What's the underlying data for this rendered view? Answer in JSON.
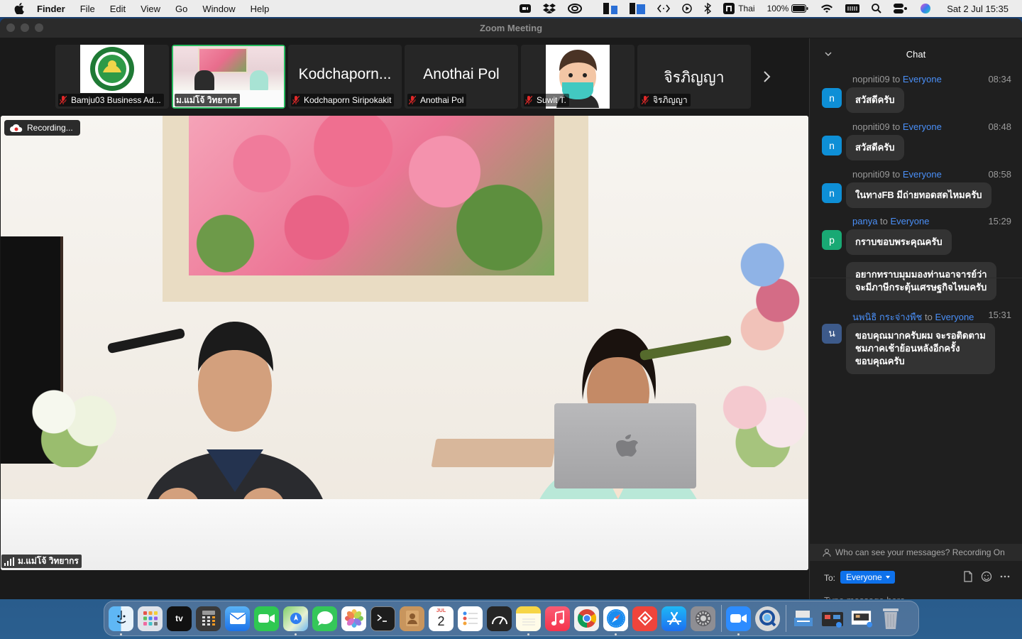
{
  "menubar": {
    "app_name": "Finder",
    "items": [
      "File",
      "Edit",
      "View",
      "Go",
      "Window",
      "Help"
    ],
    "status": {
      "input_source": "Thai",
      "battery": "100%",
      "datetime": "Sat 2 Jul  15:35"
    }
  },
  "window": {
    "title": "Zoom Meeting"
  },
  "thumbnails": [
    {
      "label": "Bamju03 Business Ad...",
      "type": "logo",
      "icon": "university-logo"
    },
    {
      "label": "ม.แม่โจ้ วิทยากร",
      "type": "camera",
      "active": true
    },
    {
      "label": "Kodchaporn Siripokakit",
      "big_name": "Kodchaporn...",
      "type": "name"
    },
    {
      "label": "Anothai Pol",
      "big_name": "Anothai Pol",
      "type": "name"
    },
    {
      "label": "Suwit T.",
      "type": "avatar",
      "icon": "masked-avatar"
    },
    {
      "label": "จิรภิญญา",
      "big_name": "จิรภิญญา",
      "type": "name"
    }
  ],
  "main_video": {
    "recording_label": "Recording...",
    "speaker_name": "ม.แม่โจ้ วิทยากร"
  },
  "chat": {
    "title": "Chat",
    "messages": [
      {
        "from": "nopniti09",
        "to_word": "to",
        "to": "Everyone",
        "time": "08:34",
        "avatar": "n",
        "avatar_color": "#0e8fd6",
        "text": "สวัสดีครับ"
      },
      {
        "from": "nopniti09",
        "to_word": "to",
        "to": "Everyone",
        "time": "08:48",
        "avatar": "n",
        "avatar_color": "#0e8fd6",
        "text": "สวัสดีครับ"
      },
      {
        "from": "nopniti09",
        "to_word": "to",
        "to": "Everyone",
        "time": "08:58",
        "avatar": "n",
        "avatar_color": "#0e8fd6",
        "text": "ในทางFB มีถ่ายทอดสดไหมครับ"
      },
      {
        "from": "panya",
        "to_word": "to",
        "to": "Everyone",
        "time": "15:29",
        "avatar": "p",
        "avatar_color": "#19a974",
        "text": "กราบขอบพระคุณครับ",
        "text2": [
          "อยากทราบมุมมองท่านอาจารย์ว่า",
          "จะมีภาษีกระตุ้นเศรษฐกิจไหมครับ"
        ]
      },
      {
        "from": "นพนิธิ กระจ่างพืช",
        "to_word": "to",
        "to": "Everyone",
        "time": "15:31",
        "avatar": "น",
        "avatar_color": "#3d5a8a",
        "text_lines": [
          "ขอบคุณมากครับผม จะรอติดตาม",
          "ชมภาคเช้าย้อนหลังอีกครั้ง",
          "ขอบคุณครับ"
        ]
      }
    ],
    "privacy_notice": "Who can see your messages? Recording On",
    "to_label": "To:",
    "recipient": "Everyone",
    "input_placeholder": "Type message here..."
  },
  "dock": {
    "apps": [
      "finder-icon",
      "launchpad-icon",
      "apple-tv-icon",
      "calculator-icon",
      "mail-icon",
      "facetime-icon",
      "maps-icon",
      "messages-icon",
      "photos-icon",
      "terminal-icon",
      "contacts-icon",
      "calendar-icon",
      "reminders-icon",
      "speed-icon",
      "notes-icon",
      "music-icon",
      "chrome-icon",
      "safari-icon",
      "anydesk-icon",
      "app-store-icon",
      "system-preferences-icon",
      "zoom-icon",
      "quicktime-icon",
      "downloads-icon",
      "documents-icon",
      "screenshot-icon",
      "trash-icon"
    ],
    "tv_label": "tv",
    "calendar_month": "JUL",
    "calendar_day": "2"
  }
}
